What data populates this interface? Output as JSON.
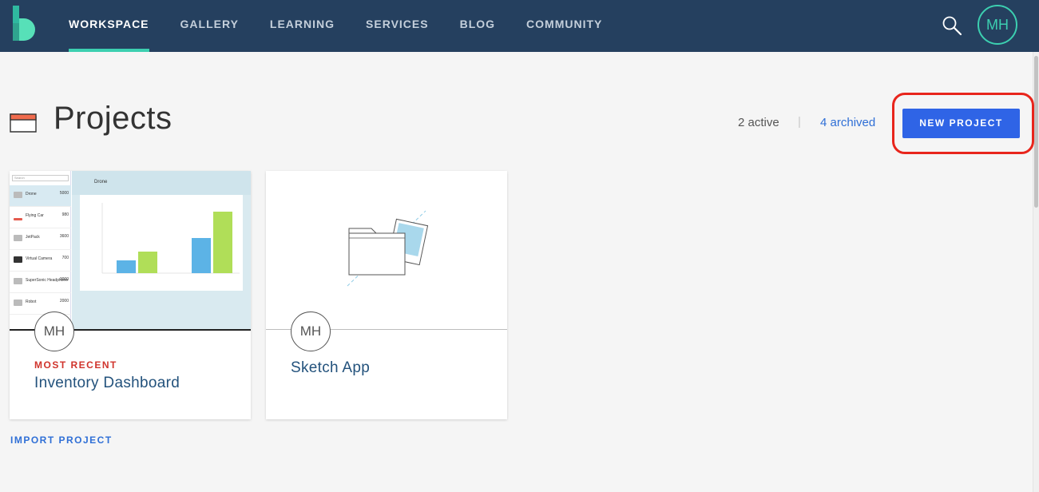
{
  "nav": {
    "items": [
      {
        "label": "WORKSPACE",
        "active": true
      },
      {
        "label": "GALLERY",
        "active": false
      },
      {
        "label": "LEARNING",
        "active": false
      },
      {
        "label": "SERVICES",
        "active": false
      },
      {
        "label": "BLOG",
        "active": false
      },
      {
        "label": "COMMUNITY",
        "active": false
      }
    ],
    "user_initials": "MH",
    "search_icon": "search-icon"
  },
  "header": {
    "title": "Projects",
    "active_count": "2 active",
    "separator": "|",
    "archived_link": "4 archived",
    "new_button": "NEW PROJECT"
  },
  "projects": [
    {
      "badge": "MOST RECENT",
      "name": "Inventory Dashboard",
      "owner_initials": "MH"
    },
    {
      "badge": "",
      "name": "Sketch App",
      "owner_initials": "MH"
    }
  ],
  "dashboard_preview": {
    "search_placeholder": "Search",
    "header_title": "Drone",
    "rows": [
      {
        "name": "Drone",
        "value": "5000"
      },
      {
        "name": "Flying Car",
        "value": "980"
      },
      {
        "name": "JetPack",
        "value": "3600"
      },
      {
        "name": "Virtual Camera",
        "value": "700"
      },
      {
        "name": "SuperSonic Headphone",
        "value": "3000"
      },
      {
        "name": "Robot",
        "value": "2000"
      }
    ]
  },
  "import_link": "IMPORT PROJECT",
  "colors": {
    "topbar": "#25405f",
    "accent_teal": "#3ccfb0",
    "primary_button": "#2f64e6",
    "recent_red": "#d0342c",
    "link_blue": "#2f6fd6",
    "annotation_ring": "#e8251c"
  }
}
